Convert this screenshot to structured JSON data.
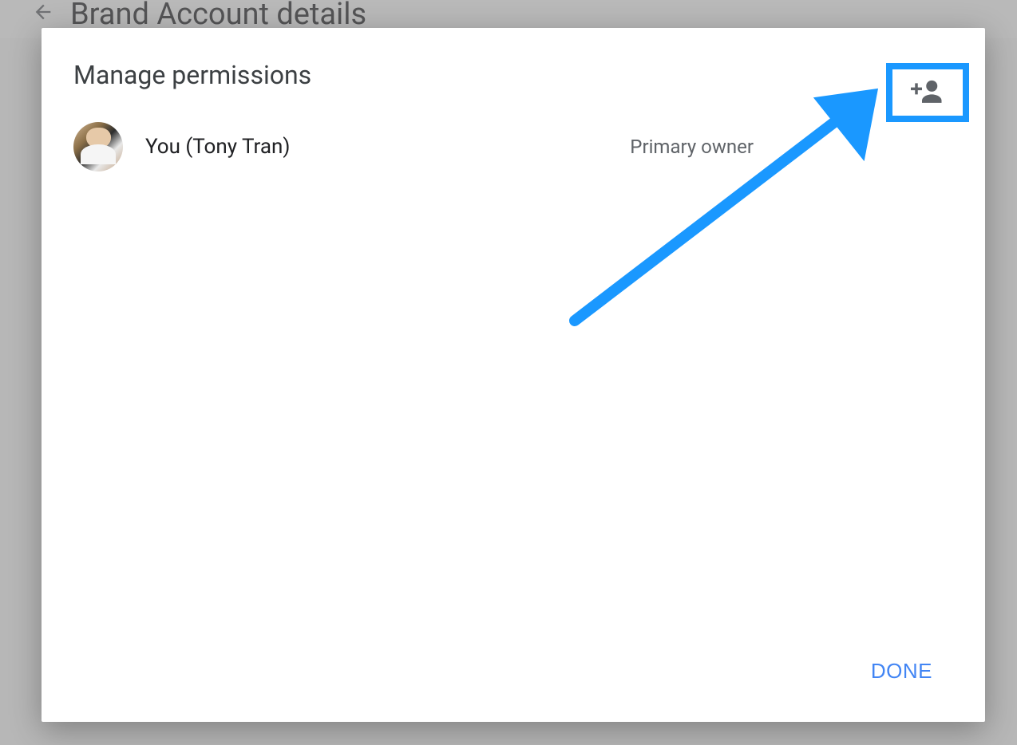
{
  "background": {
    "title": "Brand Account details"
  },
  "modal": {
    "title": "Manage permissions",
    "users": [
      {
        "name": "You (Tony Tran)",
        "role": "Primary owner"
      }
    ],
    "footer": {
      "done_label": "DONE"
    }
  },
  "annotation": {
    "highlight_color": "#1a98ff"
  }
}
